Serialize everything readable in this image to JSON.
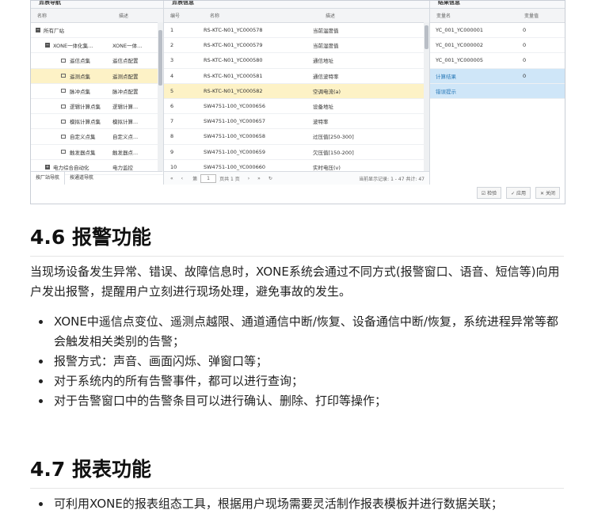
{
  "screenshot": {
    "nav_panel": {
      "title": "点表导航",
      "col_name": "名称",
      "col_desc": "描述",
      "rows": [
        {
          "name": "所有厂站",
          "desc": ""
        },
        {
          "name": "XONE一体化集...",
          "desc": "XONE一体..."
        },
        {
          "name": "遥信点集",
          "desc": "遥信点配置"
        },
        {
          "name": "遥测点集",
          "desc": "遥测点配置"
        },
        {
          "name": "脉冲点集",
          "desc": "脉冲点配置"
        },
        {
          "name": "逻辑计算点集",
          "desc": "逻辑计算..."
        },
        {
          "name": "模拟计算点集",
          "desc": "模拟计算..."
        },
        {
          "name": "自定义点集",
          "desc": "自定义点..."
        },
        {
          "name": "触发器点集",
          "desc": "触发器点..."
        },
        {
          "name": "电力综合自动化",
          "desc": "电力监控"
        }
      ],
      "tabs": [
        "按厂站导航",
        "按通道导航"
      ]
    },
    "points_panel": {
      "title": "点表信息",
      "col_no": "编号",
      "col_name": "名称",
      "col_desc": "描述",
      "rows": [
        {
          "no": "1",
          "name": "RS-KTC-N01_YC000578",
          "desc": "当前温度值"
        },
        {
          "no": "2",
          "name": "RS-KTC-N01_YC000579",
          "desc": "当前湿度值"
        },
        {
          "no": "3",
          "name": "RS-KTC-N01_YC000580",
          "desc": "通信地址"
        },
        {
          "no": "4",
          "name": "RS-KTC-N01_YC000581",
          "desc": "通信波特率"
        },
        {
          "no": "5",
          "name": "RS-KTC-N01_YC000582",
          "desc": "空调电流(a)"
        },
        {
          "no": "6",
          "name": "SW4751-100_YC000656",
          "desc": "设备地址"
        },
        {
          "no": "7",
          "name": "SW4751-100_YC000657",
          "desc": "波特率"
        },
        {
          "no": "8",
          "name": "SW4751-100_YC000658",
          "desc": "过压值[250-300]"
        },
        {
          "no": "9",
          "name": "SW4751-100_YC000659",
          "desc": "欠压值[150-200]"
        },
        {
          "no": "10",
          "name": "SW4751-100_YC000660",
          "desc": "实时电压(v)"
        }
      ],
      "pager": {
        "page_prefix": "第",
        "page_value": "1",
        "page_suffix": "页共 1 页",
        "summary": "当前显示记录: 1 - 47 共计: 47"
      }
    },
    "result_panel": {
      "title": "结果信息",
      "col_var": "变量名",
      "col_val": "变量值",
      "rows": [
        {
          "var": "YC_001_YC000001",
          "val": "0"
        },
        {
          "var": "YC_001_YC000002",
          "val": "0"
        },
        {
          "var": "YC_001_YC000005",
          "val": "0"
        },
        {
          "var": "计算结果",
          "val": "0"
        },
        {
          "var": "错误提示",
          "val": ""
        }
      ]
    },
    "buttons": {
      "verify": "检验",
      "apply": "应用",
      "close": "关闭"
    }
  },
  "section46": {
    "heading": "4.6 报警功能",
    "intro": "当现场设备发生异常、错误、故障信息时，XONE系统会通过不同方式(报警窗口、语音、短信等)向用户发出报警，提醒用户立刻进行现场处理，避免事故的发生。",
    "bullets": [
      "XONE中遥信点变位、遥测点越限、通道通信中断/恢复、设备通信中断/恢复，系统进程异常等都会触发相关类别的告警；",
      "报警方式：声音、画面闪烁、弹窗口等；",
      "对于系统内的所有告警事件，都可以进行查询；",
      "对于告警窗口中的告警条目可以进行确认、删除、打印等操作；"
    ]
  },
  "section47": {
    "heading": "4.7 报表功能",
    "bullets": [
      "可利用XONE的报表组态工具，根据用户现场需要灵活制作报表模板并进行数据关联；"
    ]
  }
}
